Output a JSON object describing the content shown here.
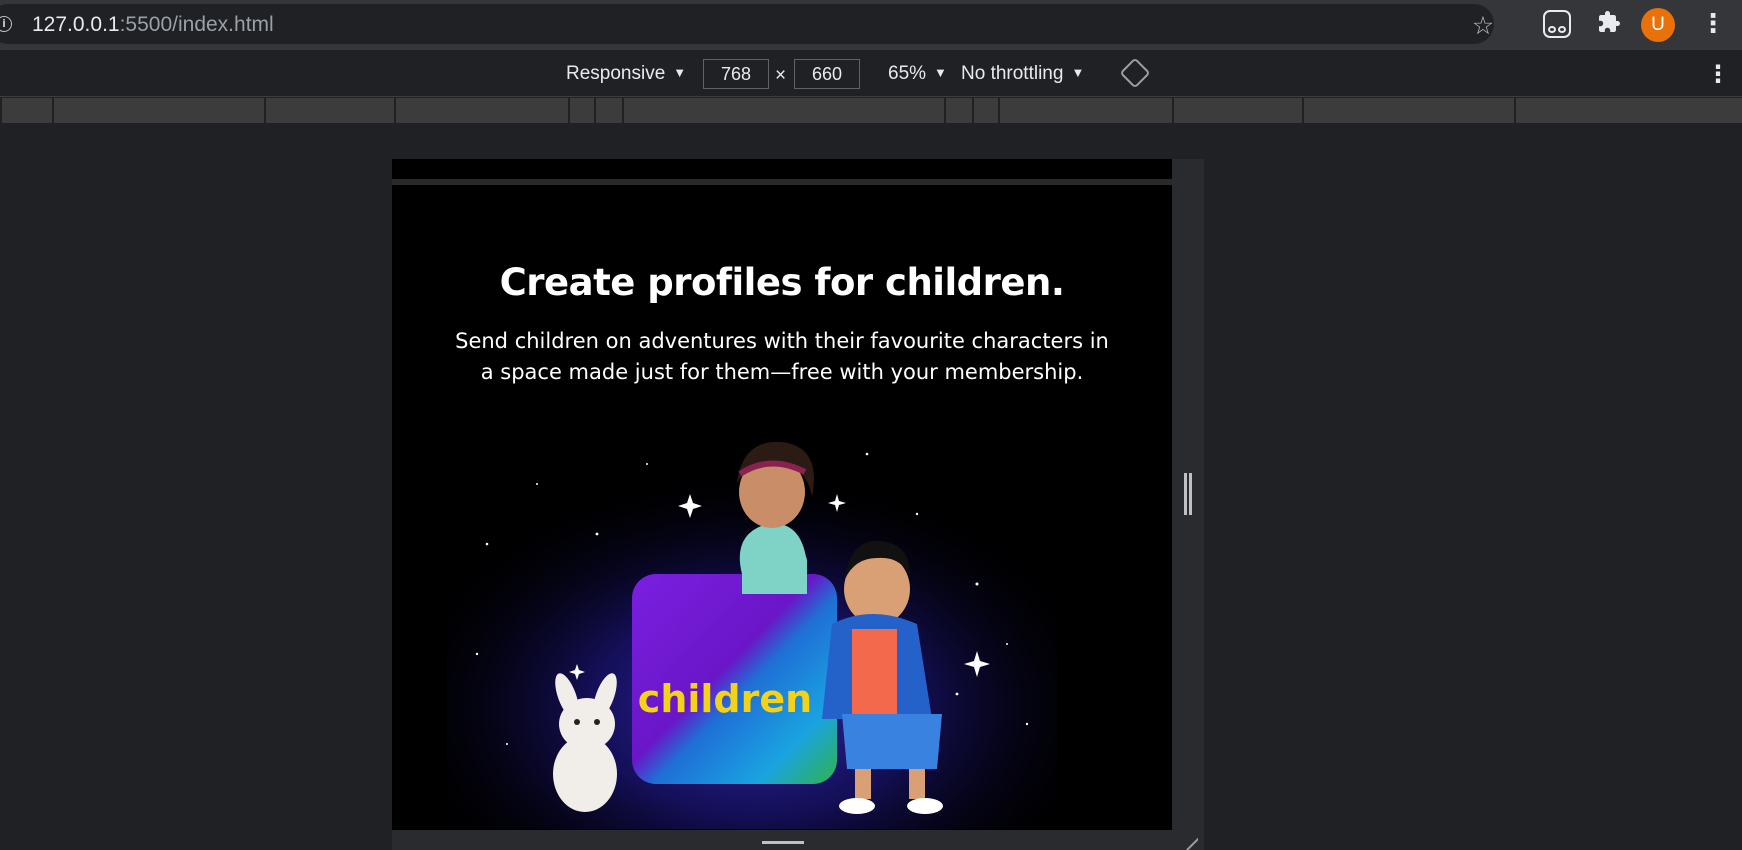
{
  "browser": {
    "url_host": "127.0.0.1",
    "url_rest": ":5500/index.html",
    "avatar_letter": "U"
  },
  "device_toolbar": {
    "device": "Responsive",
    "width": "768",
    "height": "660",
    "times": "×",
    "zoom": "65%",
    "throttling": "No throttling"
  },
  "page": {
    "title": "Create profiles for children.",
    "subtitle": "Send children on adventures with their favourite characters in a space made just for them—free with your membership.",
    "logo_text": "children"
  },
  "colors": {
    "avatar": "#e8710a",
    "logo_text": "#f5d21a",
    "glow": "#2a1fa8"
  }
}
